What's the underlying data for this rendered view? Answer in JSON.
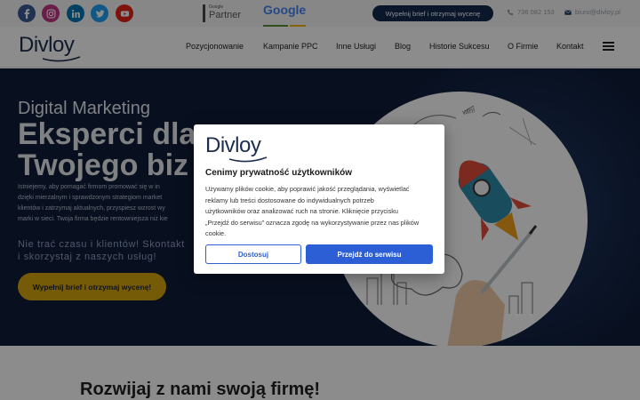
{
  "topbar": {
    "social": [
      {
        "icon": "facebook-icon",
        "color": "#3b5998"
      },
      {
        "icon": "instagram-icon",
        "color": "#c13584"
      },
      {
        "icon": "linkedin-icon",
        "color": "#0077b5"
      },
      {
        "icon": "twitter-icon",
        "color": "#1da1f2"
      },
      {
        "icon": "youtube-icon",
        "color": "#e62117"
      }
    ],
    "partner_small": "Google",
    "partner_big": "Partner",
    "google_word": "Google",
    "cta": "Wypełnij brief i otrzymaj wycenę",
    "phone": "736 082 153",
    "email": "biuro@divloy.pl"
  },
  "brand": {
    "logo": "Divloy"
  },
  "nav": {
    "items": [
      "Pozycjonowanie",
      "Kampanie PPC",
      "Inne Usługi",
      "Blog",
      "Historie Sukcesu",
      "O Firmie",
      "Kontakt"
    ]
  },
  "hero": {
    "subtitle": "Digital Marketing",
    "title_line1": "Eksperci dla",
    "title_line2": "Twojego biz",
    "body_lines": [
      "Istniejemy, aby pomagać firmom promować się w in",
      "dzięki mierzalnym i sprawdzonym strategiom market",
      "klientów i zatrzymaj aktualnych, przyspiesz wzrost wy",
      "marki w sieci. Twoja firma będzie rentowniejsza niż kie"
    ],
    "callout_lines": [
      "Nie trać czasu i klientów! Skontakt",
      "i skorzystaj z naszych usług!"
    ],
    "cta": "Wypełnij brief i otrzymaj wycenę!"
  },
  "section": {
    "title": "Rozwijaj z nami swoją firmę!"
  },
  "cookie_modal": {
    "logo": "Divloy",
    "title": "Cenimy prywatność użytkowników",
    "text_lines": [
      "Używamy plików cookie, aby poprawić jakość przeglądania, wyświetlać",
      "reklamy lub treści dostosowane do indywidualnych potrzeb",
      "użytkowników oraz analizować ruch na stronie. Kliknięcie przycisku",
      "„Przejdź do serwisu” oznacza zgodę na wykorzystywanie przez nas plików",
      "cookie."
    ],
    "customize_label": "Dostosuj",
    "accept_label": "Przejdź do serwisu"
  },
  "colors": {
    "navy": "#13294b",
    "hero_bg": "#0f1d3a",
    "gold": "#d6a40f",
    "primary_blue": "#2c5fd6"
  }
}
